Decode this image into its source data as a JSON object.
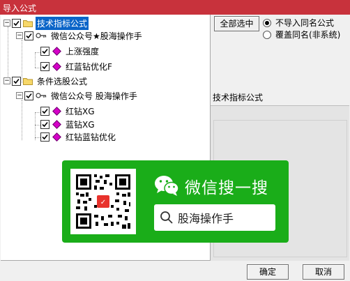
{
  "window": {
    "title": "导入公式"
  },
  "tree": {
    "nodes": [
      {
        "label": "技术指标公式",
        "level": 0,
        "type": "folder",
        "checked": true,
        "expander": "minus",
        "selected": true
      },
      {
        "label": "微信公众号★股海操作手",
        "level": 1,
        "type": "key",
        "checked": true,
        "expander": "minus"
      },
      {
        "label": "上涨强度",
        "level": 2,
        "type": "formula",
        "checked": true
      },
      {
        "label": "红蓝钻优化F",
        "level": 2,
        "type": "formula",
        "checked": true
      },
      {
        "label": "条件选股公式",
        "level": 0,
        "type": "folder",
        "checked": true,
        "expander": "minus"
      },
      {
        "label": "微信公众号 股海操作手",
        "level": 1,
        "type": "key",
        "checked": true,
        "expander": "minus"
      },
      {
        "label": "红钻XG",
        "level": 2,
        "type": "formula",
        "checked": true
      },
      {
        "label": "蓝钻XG",
        "level": 2,
        "type": "formula",
        "checked": true
      },
      {
        "label": "红钻蓝钻优化",
        "level": 2,
        "type": "formula",
        "checked": true
      }
    ]
  },
  "options": {
    "select_all_label": "全部选中",
    "radios": [
      {
        "label": "不导入同名公式",
        "selected": true
      },
      {
        "label": "覆盖同名(非系统)",
        "selected": false
      }
    ]
  },
  "details": {
    "section_label": "技术指标公式"
  },
  "actions": {
    "ok_label": "确定",
    "cancel_label": "取消"
  },
  "overlay": {
    "title": "微信搜一搜",
    "search_text": "股海操作手",
    "accent_color": "#1aad19",
    "icons": [
      "wechat-logo-icon",
      "search-icon",
      "qr-code"
    ]
  }
}
